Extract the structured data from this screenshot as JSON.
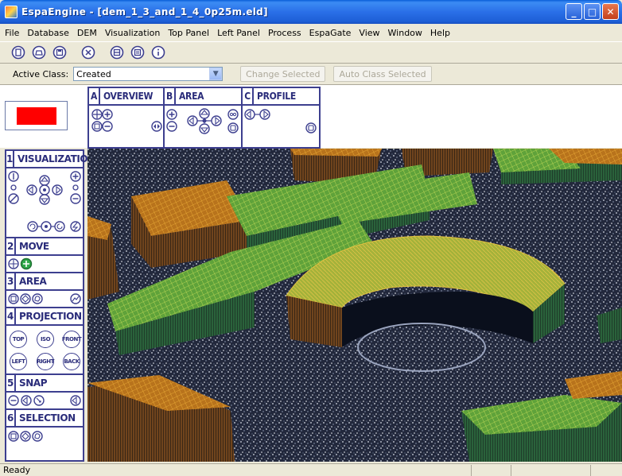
{
  "window": {
    "title": "EspaEngine - [dem_1_3_and_1_4_0p25m.eld]",
    "minimize_label": "_",
    "maximize_label": "□",
    "close_label": "✕"
  },
  "menu": [
    "File",
    "Database",
    "DEM",
    "Visualization",
    "Top Panel",
    "Left Panel",
    "Process",
    "EspaGate",
    "View",
    "Window",
    "Help"
  ],
  "toolbar": {
    "icons": [
      "new-icon",
      "open-icon",
      "save-icon",
      "close-icon",
      "layers-icon",
      "properties-icon",
      "info-icon"
    ]
  },
  "classbar": {
    "label": "Active Class:",
    "selected": "Created",
    "change_selected": "Change Selected",
    "auto_class_selected": "Auto Class Selected"
  },
  "top_panels": [
    {
      "letter": "A",
      "name": "OVERVIEW"
    },
    {
      "letter": "B",
      "name": "AREA"
    },
    {
      "letter": "C",
      "name": "PROFILE"
    }
  ],
  "left_panels": [
    {
      "num": "1",
      "name": "VISUALIZATION"
    },
    {
      "num": "2",
      "name": "MOVE"
    },
    {
      "num": "3",
      "name": "AREA"
    },
    {
      "num": "4",
      "name": "PROJECTION"
    },
    {
      "num": "5",
      "name": "SNAP"
    },
    {
      "num": "6",
      "name": "SELECTION"
    }
  ],
  "projection": {
    "top": "TOP",
    "iso": "ISO",
    "front": "FRONT",
    "left": "LEFT",
    "right": "RIGHT",
    "back": "BACK"
  },
  "status": {
    "text": "Ready"
  },
  "colors": {
    "titlebar": "#2a6fe8",
    "panel_border": "#3d3f8f",
    "active_class": "#ff0000",
    "move_accent": "#2fa84a"
  }
}
